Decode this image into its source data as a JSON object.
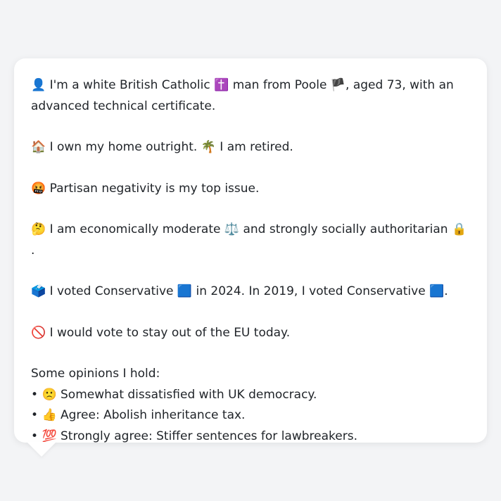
{
  "profile": {
    "identity": {
      "emoji": "👤",
      "text_a": "I'm a white British Catholic",
      "religion_emoji": "✝️",
      "text_b": "man from Poole",
      "flag_emoji": "🏴",
      "text_c": ", aged 73, with an advanced technical certificate."
    },
    "home": {
      "emoji": "🏠",
      "text_a": "I own my home outright.",
      "retired_emoji": "🌴",
      "text_b": "I am retired."
    },
    "issue": {
      "emoji": "🤬",
      "text": "Partisan negativity is my top issue."
    },
    "ideology": {
      "emoji": "🤔",
      "text_a": "I am economically moderate",
      "scale_emoji": "⚖️",
      "text_b": "and strongly socially authoritarian",
      "lock_emoji": "🔒",
      "text_c": "."
    },
    "vote": {
      "emoji": "🗳️",
      "text_a": "I voted Conservative",
      "party_emoji_1": "🟦",
      "text_b": "in 2024. In 2019, I voted Conservative",
      "party_emoji_2": "🟦",
      "text_c": "."
    },
    "eu": {
      "emoji": "🚫",
      "text": "I would vote to stay out of the EU today."
    },
    "opinions": {
      "heading": "Some opinions I hold:",
      "bullet": "•",
      "items": [
        {
          "emoji": "🙁",
          "text": "Somewhat dissatisfied with UK democracy."
        },
        {
          "emoji": "👍",
          "text": "Agree: Abolish inheritance tax."
        },
        {
          "emoji": "💯",
          "text": "Strongly agree: Stiffer sentences for lawbreakers."
        }
      ]
    }
  }
}
